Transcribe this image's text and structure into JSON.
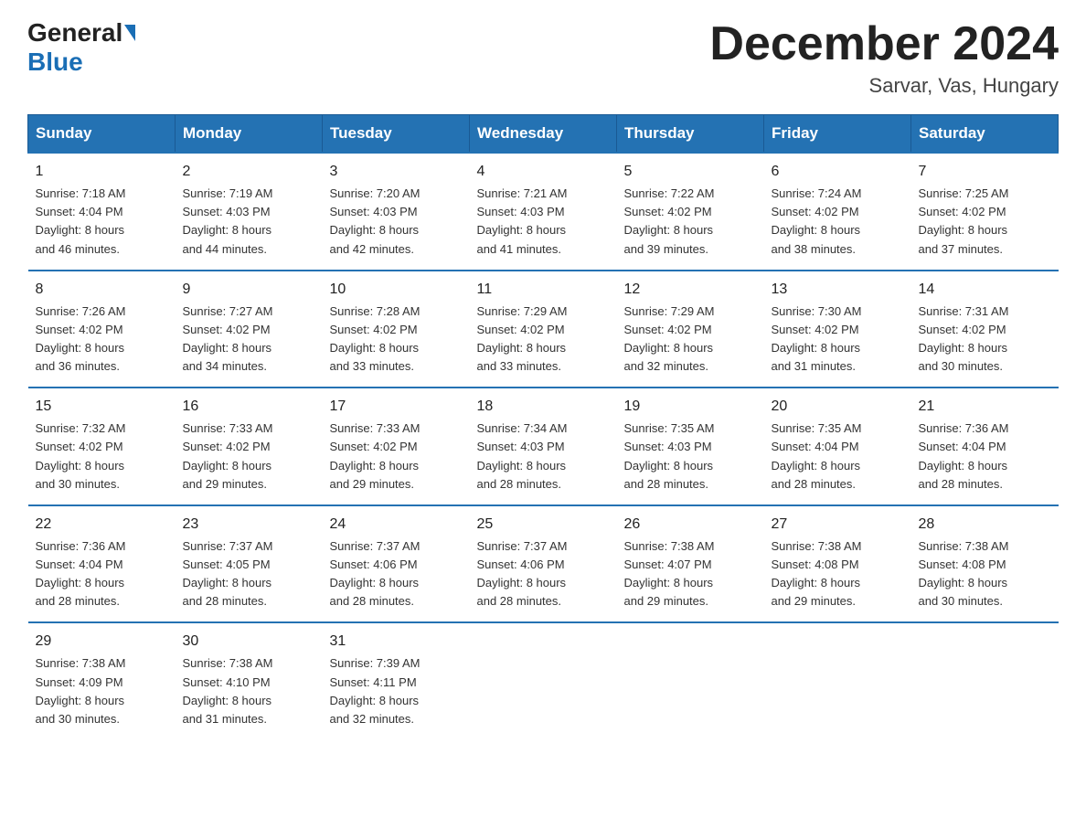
{
  "header": {
    "logo_general": "General",
    "logo_blue": "Blue",
    "month_title": "December 2024",
    "location": "Sarvar, Vas, Hungary"
  },
  "days_of_week": [
    "Sunday",
    "Monday",
    "Tuesday",
    "Wednesday",
    "Thursday",
    "Friday",
    "Saturday"
  ],
  "weeks": [
    [
      {
        "day": "1",
        "sunrise": "7:18 AM",
        "sunset": "4:04 PM",
        "daylight": "8 hours and 46 minutes."
      },
      {
        "day": "2",
        "sunrise": "7:19 AM",
        "sunset": "4:03 PM",
        "daylight": "8 hours and 44 minutes."
      },
      {
        "day": "3",
        "sunrise": "7:20 AM",
        "sunset": "4:03 PM",
        "daylight": "8 hours and 42 minutes."
      },
      {
        "day": "4",
        "sunrise": "7:21 AM",
        "sunset": "4:03 PM",
        "daylight": "8 hours and 41 minutes."
      },
      {
        "day": "5",
        "sunrise": "7:22 AM",
        "sunset": "4:02 PM",
        "daylight": "8 hours and 39 minutes."
      },
      {
        "day": "6",
        "sunrise": "7:24 AM",
        "sunset": "4:02 PM",
        "daylight": "8 hours and 38 minutes."
      },
      {
        "day": "7",
        "sunrise": "7:25 AM",
        "sunset": "4:02 PM",
        "daylight": "8 hours and 37 minutes."
      }
    ],
    [
      {
        "day": "8",
        "sunrise": "7:26 AM",
        "sunset": "4:02 PM",
        "daylight": "8 hours and 36 minutes."
      },
      {
        "day": "9",
        "sunrise": "7:27 AM",
        "sunset": "4:02 PM",
        "daylight": "8 hours and 34 minutes."
      },
      {
        "day": "10",
        "sunrise": "7:28 AM",
        "sunset": "4:02 PM",
        "daylight": "8 hours and 33 minutes."
      },
      {
        "day": "11",
        "sunrise": "7:29 AM",
        "sunset": "4:02 PM",
        "daylight": "8 hours and 33 minutes."
      },
      {
        "day": "12",
        "sunrise": "7:29 AM",
        "sunset": "4:02 PM",
        "daylight": "8 hours and 32 minutes."
      },
      {
        "day": "13",
        "sunrise": "7:30 AM",
        "sunset": "4:02 PM",
        "daylight": "8 hours and 31 minutes."
      },
      {
        "day": "14",
        "sunrise": "7:31 AM",
        "sunset": "4:02 PM",
        "daylight": "8 hours and 30 minutes."
      }
    ],
    [
      {
        "day": "15",
        "sunrise": "7:32 AM",
        "sunset": "4:02 PM",
        "daylight": "8 hours and 30 minutes."
      },
      {
        "day": "16",
        "sunrise": "7:33 AM",
        "sunset": "4:02 PM",
        "daylight": "8 hours and 29 minutes."
      },
      {
        "day": "17",
        "sunrise": "7:33 AM",
        "sunset": "4:02 PM",
        "daylight": "8 hours and 29 minutes."
      },
      {
        "day": "18",
        "sunrise": "7:34 AM",
        "sunset": "4:03 PM",
        "daylight": "8 hours and 28 minutes."
      },
      {
        "day": "19",
        "sunrise": "7:35 AM",
        "sunset": "4:03 PM",
        "daylight": "8 hours and 28 minutes."
      },
      {
        "day": "20",
        "sunrise": "7:35 AM",
        "sunset": "4:04 PM",
        "daylight": "8 hours and 28 minutes."
      },
      {
        "day": "21",
        "sunrise": "7:36 AM",
        "sunset": "4:04 PM",
        "daylight": "8 hours and 28 minutes."
      }
    ],
    [
      {
        "day": "22",
        "sunrise": "7:36 AM",
        "sunset": "4:04 PM",
        "daylight": "8 hours and 28 minutes."
      },
      {
        "day": "23",
        "sunrise": "7:37 AM",
        "sunset": "4:05 PM",
        "daylight": "8 hours and 28 minutes."
      },
      {
        "day": "24",
        "sunrise": "7:37 AM",
        "sunset": "4:06 PM",
        "daylight": "8 hours and 28 minutes."
      },
      {
        "day": "25",
        "sunrise": "7:37 AM",
        "sunset": "4:06 PM",
        "daylight": "8 hours and 28 minutes."
      },
      {
        "day": "26",
        "sunrise": "7:38 AM",
        "sunset": "4:07 PM",
        "daylight": "8 hours and 29 minutes."
      },
      {
        "day": "27",
        "sunrise": "7:38 AM",
        "sunset": "4:08 PM",
        "daylight": "8 hours and 29 minutes."
      },
      {
        "day": "28",
        "sunrise": "7:38 AM",
        "sunset": "4:08 PM",
        "daylight": "8 hours and 30 minutes."
      }
    ],
    [
      {
        "day": "29",
        "sunrise": "7:38 AM",
        "sunset": "4:09 PM",
        "daylight": "8 hours and 30 minutes."
      },
      {
        "day": "30",
        "sunrise": "7:38 AM",
        "sunset": "4:10 PM",
        "daylight": "8 hours and 31 minutes."
      },
      {
        "day": "31",
        "sunrise": "7:39 AM",
        "sunset": "4:11 PM",
        "daylight": "8 hours and 32 minutes."
      },
      null,
      null,
      null,
      null
    ]
  ],
  "labels": {
    "sunrise": "Sunrise:",
    "sunset": "Sunset:",
    "daylight": "Daylight:"
  }
}
